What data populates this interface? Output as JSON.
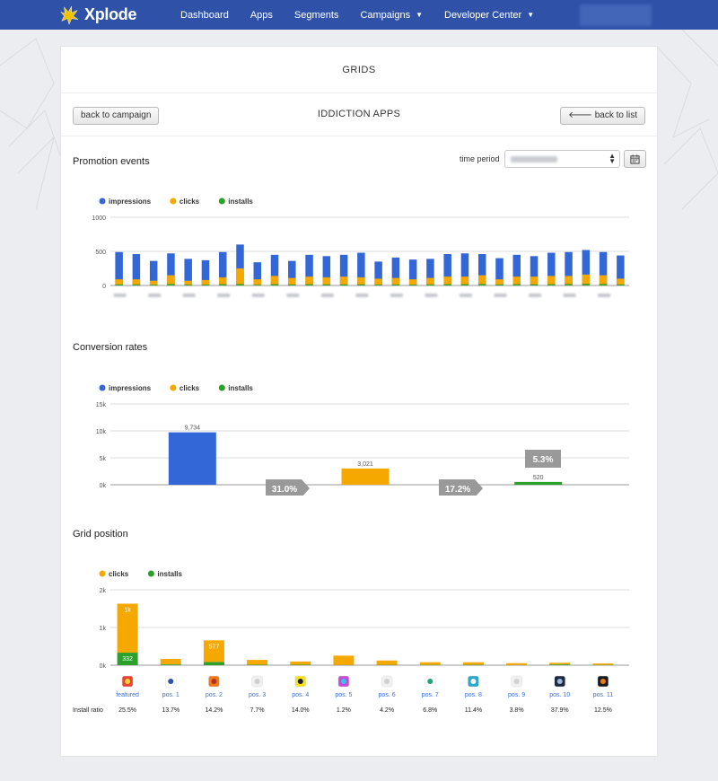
{
  "nav": {
    "brand": "Xplode",
    "items": [
      {
        "label": "Dashboard",
        "caret": false
      },
      {
        "label": "Apps",
        "caret": false
      },
      {
        "label": "Segments",
        "caret": false
      },
      {
        "label": "Campaigns",
        "caret": true
      },
      {
        "label": "Developer Center",
        "caret": true
      }
    ]
  },
  "panel": {
    "title": "GRIDS",
    "back_campaign_label": "back to campaign",
    "subtitle": "IDDICTION APPS",
    "back_list_label": "back to list",
    "back_list_icon": "arrow-left-icon",
    "calendar_icon": "calendar-icon"
  },
  "promotion": {
    "title": "Promotion events",
    "time_period_label": "time period"
  },
  "conversion": {
    "title": "Conversion rates"
  },
  "grid_position": {
    "title": "Grid position",
    "install_ratio_label": "Install ratio"
  },
  "colors": {
    "impressions": "#3366d6",
    "clicks": "#f5a800",
    "installs": "#2ba02b",
    "navbar": "#2f52a8",
    "rate_arrow": "#999999"
  },
  "chart_data": [
    {
      "type": "bar",
      "stacked": true,
      "series": [
        {
          "name": "impressions",
          "values": [
            490,
            460,
            360,
            470,
            390,
            370,
            490,
            600,
            340,
            450,
            360,
            450,
            430,
            450,
            480,
            350,
            410,
            380,
            390,
            460,
            470,
            460,
            400,
            450,
            430,
            480,
            490,
            520,
            490,
            440
          ]
        },
        {
          "name": "clicks",
          "values": [
            90,
            90,
            70,
            150,
            70,
            80,
            120,
            250,
            90,
            140,
            110,
            130,
            120,
            130,
            120,
            100,
            110,
            90,
            110,
            130,
            130,
            150,
            90,
            130,
            130,
            140,
            140,
            160,
            150,
            100
          ]
        },
        {
          "name": "installs",
          "values": [
            15,
            15,
            10,
            20,
            12,
            12,
            18,
            20,
            10,
            18,
            14,
            18,
            15,
            15,
            16,
            12,
            14,
            12,
            14,
            18,
            18,
            20,
            14,
            18,
            16,
            18,
            20,
            22,
            20,
            15
          ]
        }
      ],
      "ylim": [
        0,
        1000
      ],
      "yticks": [
        "0",
        "500",
        "1000"
      ],
      "legend": "top-left",
      "grid": true
    },
    {
      "type": "bar",
      "series": [
        {
          "name": "impressions",
          "values": [
            9734
          ]
        },
        {
          "name": "clicks",
          "values": [
            3021
          ]
        },
        {
          "name": "installs",
          "values": [
            520
          ]
        }
      ],
      "data_labels": [
        "9,734",
        "3,021",
        "520"
      ],
      "rates": [
        "31.0%",
        "17.2%",
        "5.3%"
      ],
      "ylim": [
        0,
        15000
      ],
      "yticks": [
        "0k",
        "5k",
        "10k",
        "15k"
      ],
      "legend": "top-left",
      "grid": true
    },
    {
      "type": "bar",
      "stacked": true,
      "categories": [
        "featured",
        "pos. 1",
        "pos. 2",
        "pos. 3",
        "pos. 4",
        "pos. 5",
        "pos. 6",
        "pos. 7",
        "pos. 8",
        "pos. 9",
        "pos. 10",
        "pos. 11"
      ],
      "series": [
        {
          "name": "installs",
          "values": [
            332,
            20,
            82,
            10,
            12,
            3,
            5,
            5,
            8,
            2,
            18,
            5
          ]
        },
        {
          "name": "clicks",
          "values": [
            1300,
            146,
            577,
            130,
            86,
            250,
            119,
            73,
            70,
            52,
            47,
            40
          ]
        }
      ],
      "data_labels": [
        "1k",
        "",
        "577",
        "",
        "",
        "",
        "",
        "",
        "",
        "",
        "",
        ""
      ],
      "install_data_labels": [
        "332",
        "",
        "",
        "",
        "",
        "",
        "",
        "",
        "",
        "",
        "",
        ""
      ],
      "install_ratio": [
        "25.5%",
        "13.7%",
        "14.2%",
        "7.7%",
        "14.0%",
        "1.2%",
        "4.2%",
        "6.8%",
        "11.4%",
        "3.8%",
        "37.9%",
        "12.5%"
      ],
      "icons": [
        "app-icon-red",
        "app-icon-dots",
        "app-icon-orange",
        "app-icon-placeholder",
        "app-icon-yellow",
        "app-icon-rainbow",
        "app-icon-placeholder",
        "app-icon-green-x",
        "app-icon-teal",
        "app-icon-placeholder",
        "app-icon-dark",
        "app-icon-black"
      ],
      "ylim": [
        0,
        2000
      ],
      "yticks": [
        "0k",
        "1k",
        "2k"
      ],
      "legend": "top-left",
      "grid": true
    }
  ]
}
